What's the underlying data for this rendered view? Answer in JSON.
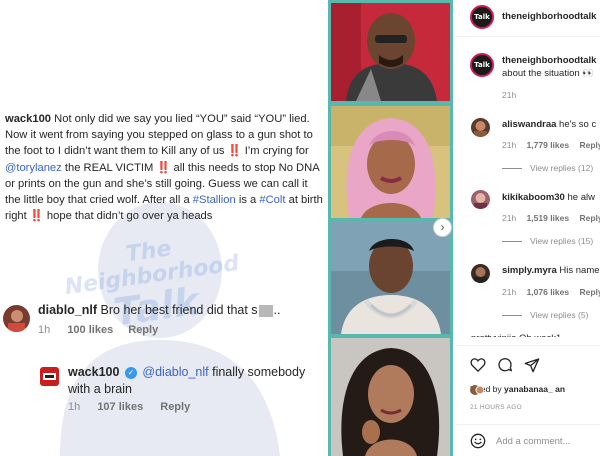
{
  "left_panel": {
    "watermark": {
      "line1": "The",
      "line2": "Neighborhood",
      "line3": "Talk"
    },
    "post": {
      "username": "wack100",
      "text_a": "Not only did we say you lied “YOU” said “YOU” lied. Now it went from saying you stepped on glass to a gun shot to the foot to I didn’t want them to Kill any of us",
      "bang": "‼️",
      "text_b": "I’m crying for",
      "mention": "@torylanez",
      "text_c": "the REAL VICTIM",
      "text_d": "all this needs to stop No DNA or prints on the gun and she’s still going. Guess we can call it the little boy that cried wolf. After all a",
      "hashtag1": "#Stallion",
      "text_e": "is a",
      "hashtag2": "#Colt",
      "text_f": "at birth right",
      "text_g": "hope that didn’t go over ya heads"
    },
    "comment1": {
      "username": "diablo_nlf",
      "text": "Bro her best friend did that s",
      "text_end": "..",
      "time": "1h",
      "likes": "100 likes",
      "reply_label": "Reply"
    },
    "reply1": {
      "username": "wack100",
      "mention": "@diablo_nlf",
      "text": "finally somebody with a brain",
      "time": "1h",
      "likes": "107 likes",
      "reply_label": "Reply"
    }
  },
  "right_panel": {
    "header_username": "theneighborhoodtalk",
    "logo_text": "Talk",
    "caption": {
      "username": "theneighborhoodtalk",
      "text": "about the situation 👀",
      "time": "21h"
    },
    "comments": [
      {
        "username": "aliswandraa",
        "text": "he's so c",
        "time": "21h",
        "likes": "1,779 likes",
        "reply": "Reply",
        "view": "View replies (12)"
      },
      {
        "username": "kikikaboom30",
        "text": "he alw",
        "time": "21h",
        "likes": "1,519 likes",
        "reply": "Reply",
        "view": "View replies (15)"
      },
      {
        "username": "simply.myra",
        "text": "His name",
        "time": "21h",
        "likes": "1,076 likes",
        "reply": "Reply",
        "view": "View replies (5)"
      }
    ],
    "peek_text": "prettyviniie Oh wack1",
    "liked_by_prefix": "Liked by",
    "liked_by_user": "yanabanaa_",
    "liked_by_suffix": "an",
    "time_ago": "21 HOURS AGO",
    "add_comment_placeholder": "Add a comment..."
  },
  "icons": [
    "heart-icon",
    "comment-icon",
    "share-icon",
    "emoji-icon",
    "carousel-next-icon",
    "verified-icon"
  ],
  "colors": {
    "strip": "#59b8ae",
    "mention": "#3a64c8",
    "bang": "#e3242b",
    "logo_ring": "#c81e55"
  }
}
